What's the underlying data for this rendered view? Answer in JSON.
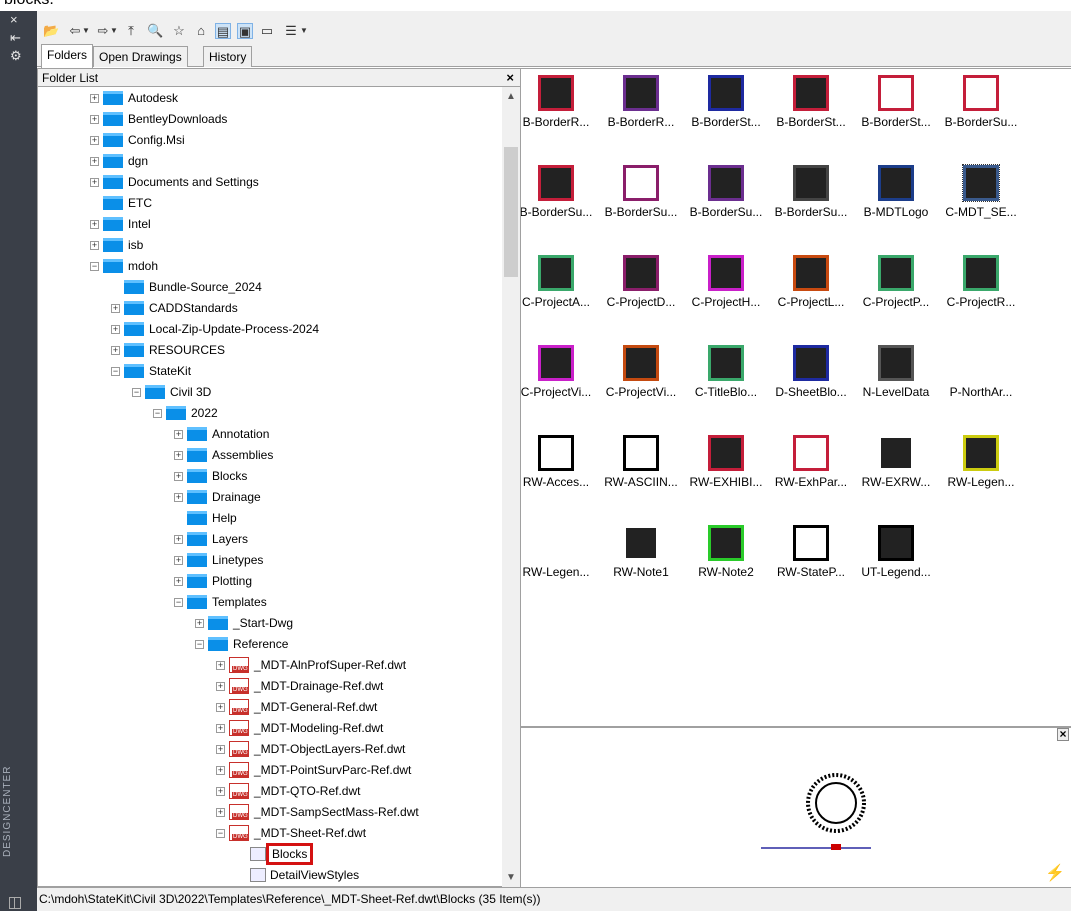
{
  "top_cut_text": "blocks.",
  "side": {
    "close": "×",
    "pin": "⇤",
    "settings": "⚙",
    "vertical_title": "DESIGNCENTER"
  },
  "tabs": [
    "Folders",
    "Open Drawings",
    "History"
  ],
  "folder_list": {
    "title": "Folder List",
    "close": "×"
  },
  "tree": [
    {
      "label": "Autodesk",
      "indent": 0,
      "icon": "folder",
      "exp": "+"
    },
    {
      "label": "BentleyDownloads",
      "indent": 0,
      "icon": "folder",
      "exp": "+"
    },
    {
      "label": "Config.Msi",
      "indent": 0,
      "icon": "folder",
      "exp": "+"
    },
    {
      "label": "dgn",
      "indent": 0,
      "icon": "folder",
      "exp": "+"
    },
    {
      "label": "Documents and Settings",
      "indent": 0,
      "icon": "folder",
      "exp": "+"
    },
    {
      "label": "ETC",
      "indent": 0,
      "icon": "folder",
      "exp": ""
    },
    {
      "label": "Intel",
      "indent": 0,
      "icon": "folder",
      "exp": "+"
    },
    {
      "label": "isb",
      "indent": 0,
      "icon": "folder",
      "exp": "+"
    },
    {
      "label": "mdoh",
      "indent": 0,
      "icon": "folder",
      "exp": "-"
    },
    {
      "label": "Bundle-Source_2024",
      "indent": 1,
      "icon": "folder",
      "exp": ""
    },
    {
      "label": "CADDStandards",
      "indent": 1,
      "icon": "folder",
      "exp": "+"
    },
    {
      "label": "Local-Zip-Update-Process-2024",
      "indent": 1,
      "icon": "folder",
      "exp": "+"
    },
    {
      "label": "RESOURCES",
      "indent": 1,
      "icon": "folder",
      "exp": "+"
    },
    {
      "label": "StateKit",
      "indent": 1,
      "icon": "folder",
      "exp": "-"
    },
    {
      "label": "Civil 3D",
      "indent": 2,
      "icon": "folder",
      "exp": "-"
    },
    {
      "label": "2022",
      "indent": 3,
      "icon": "folder",
      "exp": "-"
    },
    {
      "label": "Annotation",
      "indent": 4,
      "icon": "folder",
      "exp": "+"
    },
    {
      "label": "Assemblies",
      "indent": 4,
      "icon": "folder",
      "exp": "+"
    },
    {
      "label": "Blocks",
      "indent": 4,
      "icon": "folder",
      "exp": "+"
    },
    {
      "label": "Drainage",
      "indent": 4,
      "icon": "folder",
      "exp": "+"
    },
    {
      "label": "Help",
      "indent": 4,
      "icon": "folder",
      "exp": ""
    },
    {
      "label": "Layers",
      "indent": 4,
      "icon": "folder",
      "exp": "+"
    },
    {
      "label": "Linetypes",
      "indent": 4,
      "icon": "folder",
      "exp": "+"
    },
    {
      "label": "Plotting",
      "indent": 4,
      "icon": "folder",
      "exp": "+"
    },
    {
      "label": "Templates",
      "indent": 4,
      "icon": "folder",
      "exp": "-"
    },
    {
      "label": "_Start-Dwg",
      "indent": 5,
      "icon": "folder",
      "exp": "+"
    },
    {
      "label": "Reference",
      "indent": 5,
      "icon": "folder",
      "exp": "-"
    },
    {
      "label": "_MDT-AlnProfSuper-Ref.dwt",
      "indent": 6,
      "icon": "dwg",
      "exp": "+"
    },
    {
      "label": "_MDT-Drainage-Ref.dwt",
      "indent": 6,
      "icon": "dwg",
      "exp": "+"
    },
    {
      "label": "_MDT-General-Ref.dwt",
      "indent": 6,
      "icon": "dwg",
      "exp": "+"
    },
    {
      "label": "_MDT-Modeling-Ref.dwt",
      "indent": 6,
      "icon": "dwg",
      "exp": "+"
    },
    {
      "label": "_MDT-ObjectLayers-Ref.dwt",
      "indent": 6,
      "icon": "dwg",
      "exp": "+"
    },
    {
      "label": "_MDT-PointSurvParc-Ref.dwt",
      "indent": 6,
      "icon": "dwg",
      "exp": "+"
    },
    {
      "label": "_MDT-QTO-Ref.dwt",
      "indent": 6,
      "icon": "dwg",
      "exp": "+"
    },
    {
      "label": "_MDT-SampSectMass-Ref.dwt",
      "indent": 6,
      "icon": "dwg",
      "exp": "+"
    },
    {
      "label": "_MDT-Sheet-Ref.dwt",
      "indent": 6,
      "icon": "dwg",
      "exp": "-"
    },
    {
      "label": "Blocks",
      "indent": 7,
      "icon": "block",
      "exp": "",
      "highlight": true
    },
    {
      "label": "DetailViewStyles",
      "indent": 7,
      "icon": "block",
      "exp": ""
    }
  ],
  "items": [
    "B-BorderR...",
    "B-BorderR...",
    "B-BorderSt...",
    "B-BorderSt...",
    "B-BorderSt...",
    "B-BorderSu...",
    "B-BorderSu...",
    "B-BorderSu...",
    "B-BorderSu...",
    "B-BorderSu...",
    "B-MDTLogo",
    "C-MDT_SE...",
    "C-ProjectA...",
    "C-ProjectD...",
    "C-ProjectH...",
    "C-ProjectL...",
    "C-ProjectP...",
    "C-ProjectR...",
    "C-ProjectVi...",
    "C-ProjectVi...",
    "C-TitleBlo...",
    "D-SheetBlo...",
    "N-LevelData",
    "P-NorthAr...",
    "RW-Acces...",
    "RW-ASCIIN...",
    "RW-EXHIBI...",
    "RW-ExhPar...",
    "RW-EXRW...",
    "RW-Legen...",
    "RW-Legen...",
    "RW-Note1",
    "RW-Note2",
    "RW-StateP...",
    "UT-Legend..."
  ],
  "selected_item": "C-MDT_SE...",
  "status": "C:\\mdoh\\StateKit\\Civil 3D\\2022\\Templates\\Reference\\_MDT-Sheet-Ref.dwt\\Blocks (35 Item(s))",
  "colors": {
    "accent": "#0a8fe8",
    "highlight": "#d41111"
  }
}
